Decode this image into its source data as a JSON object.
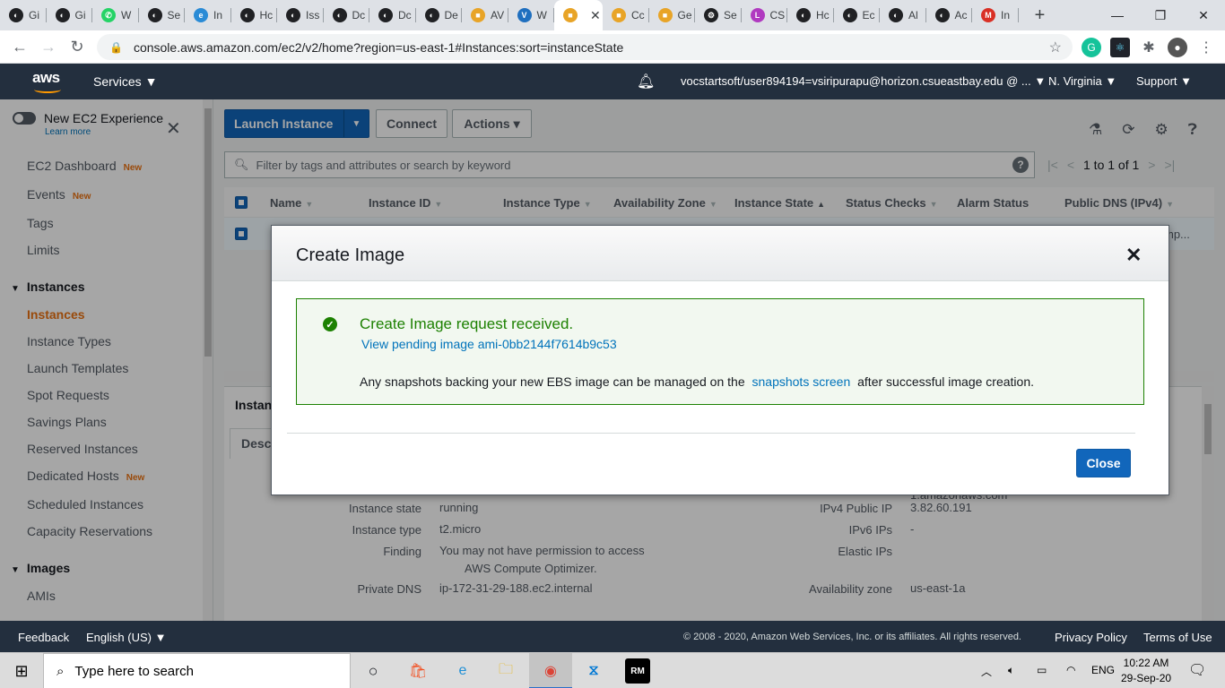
{
  "browser": {
    "tabs": [
      {
        "label": "Gi",
        "icon": "github-icon",
        "color": "#202124"
      },
      {
        "label": "Gi",
        "icon": "github-icon",
        "color": "#202124"
      },
      {
        "label": "W",
        "icon": "whatsapp-icon",
        "color": "#25d366"
      },
      {
        "label": "Se",
        "icon": "github-icon",
        "color": "#202124"
      },
      {
        "label": "In",
        "icon": "edge-icon",
        "color": "#2a8bd6"
      },
      {
        "label": "Hc",
        "icon": "github-icon",
        "color": "#202124"
      },
      {
        "label": "Iss",
        "icon": "github-icon",
        "color": "#202124"
      },
      {
        "label": "Dc",
        "icon": "github-icon",
        "color": "#202124"
      },
      {
        "label": "Dc",
        "icon": "github-icon",
        "color": "#202124"
      },
      {
        "label": "De",
        "icon": "github-icon",
        "color": "#202124"
      },
      {
        "label": "AV",
        "icon": "aws-box-icon",
        "color": "#e8a427"
      },
      {
        "label": "W",
        "icon": "v-icon",
        "color": "#1f6fbf"
      },
      {
        "label": "",
        "icon": "aws-box-icon",
        "color": "#e8a427",
        "active": true
      },
      {
        "label": "Cc",
        "icon": "aws-box-icon",
        "color": "#e8a427"
      },
      {
        "label": "Ge",
        "icon": "aws-box-icon",
        "color": "#e8a427"
      },
      {
        "label": "Se",
        "icon": "gear-icon",
        "color": "#202124"
      },
      {
        "label": "CS",
        "icon": "lc-icon",
        "color": "#b03ac0"
      },
      {
        "label": "Hc",
        "icon": "github-icon",
        "color": "#202124"
      },
      {
        "label": "Ec",
        "icon": "github-icon",
        "color": "#202124"
      },
      {
        "label": "Al",
        "icon": "github-icon",
        "color": "#202124"
      },
      {
        "label": "Ac",
        "icon": "github-icon",
        "color": "#202124"
      },
      {
        "label": "In",
        "icon": "gmail-icon",
        "color": "#d93025"
      }
    ],
    "url": "console.aws.amazon.com/ec2/v2/home?region=us-east-1#Instances:sort=instanceState"
  },
  "awsnav": {
    "logo": "aws",
    "services": "Services ▼",
    "account": "vocstartsoft/user894194=vsiripurapu@horizon.csueastbay.edu @ ...  ▼",
    "region": "N. Virginia  ▼",
    "support": "Support  ▼"
  },
  "sidebar": {
    "new_experience": "New EC2 Experience",
    "learn_more": "Learn more",
    "new_badge": "New",
    "items": [
      {
        "label": "EC2 Dashboard",
        "new": true
      },
      {
        "label": "Events",
        "new": true
      },
      {
        "label": "Tags"
      },
      {
        "label": "Limits"
      }
    ],
    "instances_head": "Instances",
    "instances_items": [
      {
        "label": "Instances",
        "active": true
      },
      {
        "label": "Instance Types"
      },
      {
        "label": "Launch Templates"
      },
      {
        "label": "Spot Requests"
      },
      {
        "label": "Savings Plans"
      },
      {
        "label": "Reserved Instances"
      },
      {
        "label": "Dedicated Hosts",
        "new": true
      },
      {
        "label": "Scheduled Instances"
      },
      {
        "label": "Capacity Reservations"
      }
    ],
    "images_head": "Images",
    "images_items": [
      {
        "label": "AMIs"
      }
    ]
  },
  "toolbar": {
    "launch": "Launch Instance",
    "connect": "Connect",
    "actions": "Actions ▾"
  },
  "filter": {
    "placeholder": "Filter by tags and attributes or search by keyword",
    "pager": "1 to 1 of 1"
  },
  "table": {
    "columns": [
      "Name",
      "Instance ID",
      "Instance Type",
      "Availability Zone",
      "Instance State",
      "Status Checks",
      "Alarm Status",
      "Public DNS (IPv4)"
    ],
    "row_dns_fragment": "mp..."
  },
  "detail": {
    "title": "Instan",
    "tab": "Desc",
    "dns_fragment": "1.amazonaws.com",
    "left": [
      {
        "label": "Instance state",
        "value": "running"
      },
      {
        "label": "Instance type",
        "value": "t2.micro"
      },
      {
        "label": "Finding",
        "value": "You may not have permission to access",
        "value2": "AWS Compute Optimizer."
      },
      {
        "label": "Private DNS",
        "value": "ip-172-31-29-188.ec2.internal"
      }
    ],
    "right": [
      {
        "label": "IPv4 Public IP",
        "value": "3.82.60.191"
      },
      {
        "label": "IPv6 IPs",
        "value": "-"
      },
      {
        "label": "Elastic IPs",
        "value": ""
      },
      {
        "label": "Availability zone",
        "value": "us-east-1a"
      }
    ]
  },
  "modal": {
    "title": "Create Image",
    "alert_title": "Create Image request received.",
    "alert_link": "View pending image ami-0bb2144f7614b9c53",
    "alert_body_pre": "Any snapshots backing your new EBS image can be managed on the",
    "alert_body_link": "snapshots screen",
    "alert_body_post": "after successful image creation.",
    "close": "Close"
  },
  "footer": {
    "feedback": "Feedback",
    "language": "English (US)  ▼",
    "copyright": "© 2008 - 2020, Amazon Web Services, Inc. or its affiliates. All rights reserved.",
    "privacy": "Privacy Policy",
    "terms": "Terms of Use"
  },
  "taskbar": {
    "search_placeholder": "Type here to search",
    "lang": "ENG",
    "time": "10:22 AM",
    "date": "29-Sep-20"
  },
  "colors": {
    "aws_nav": "#232f3e",
    "primary_blue": "#1166bb",
    "success_green": "#1d8102",
    "active_orange": "#ec7211"
  }
}
